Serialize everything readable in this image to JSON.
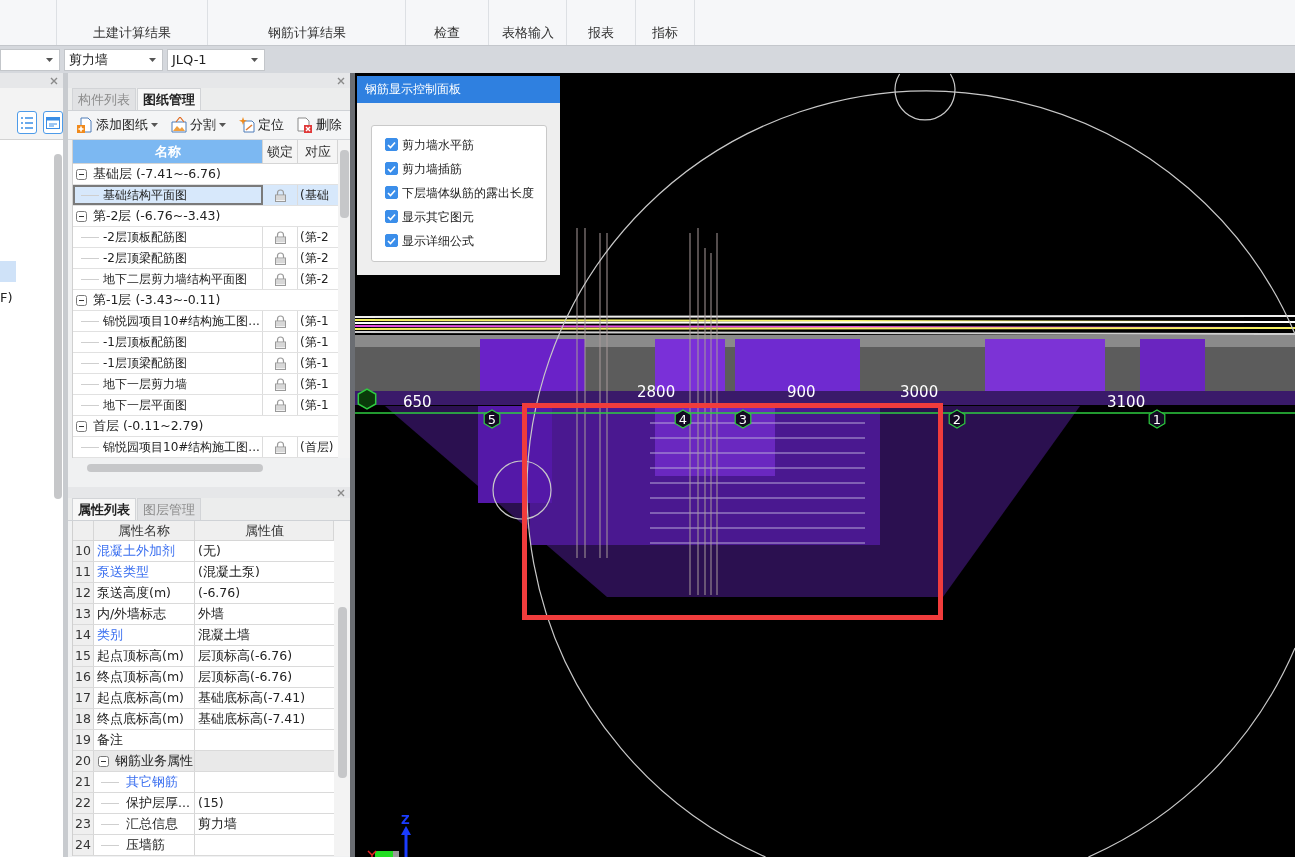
{
  "ribbon": {
    "groups": [
      {
        "label": "土建计算结果"
      },
      {
        "label": "钢筋计算结果"
      },
      {
        "label": "检查"
      },
      {
        "label": "表格输入"
      },
      {
        "label": "报表"
      },
      {
        "label": "指标"
      }
    ]
  },
  "selectors": [
    {
      "kind": "combo"
    },
    {
      "kind": "combo",
      "value": "剪力墙"
    },
    {
      "kind": "combo",
      "value": "JLQ-1"
    }
  ],
  "left_panel": {
    "items": [
      {
        "selected": true
      },
      {
        "label": "F)",
        "selected": false
      }
    ]
  },
  "drawing_panel": {
    "tabs": [
      {
        "label": "构件列表",
        "selected": false
      },
      {
        "label": "图纸管理",
        "selected": true
      }
    ],
    "toolbar": [
      {
        "kind": "add",
        "label": "添加图纸",
        "dropdown": true
      },
      {
        "kind": "split",
        "label": "分割",
        "dropdown": true
      },
      {
        "kind": "locate",
        "label": "定位",
        "dropdown": false
      },
      {
        "kind": "delete",
        "label": "删除",
        "dropdown": false
      }
    ],
    "columns": [
      {
        "label": "名称",
        "selected": true
      },
      {
        "label": "锁定",
        "selected": false
      },
      {
        "label": "对应",
        "selected": false
      }
    ],
    "groups": [
      {
        "label": "基础层 (-7.41~-6.76)",
        "expanded": true,
        "children": [
          {
            "name": "基础结构平面图",
            "locked": true,
            "floor": "(基础",
            "selected": true
          }
        ]
      },
      {
        "label": "第-2层 (-6.76~-3.43)",
        "expanded": true,
        "children": [
          {
            "name": "-2层顶板配筋图",
            "locked": true,
            "floor": "(第-2",
            "selected": false
          },
          {
            "name": "-2层顶梁配筋图",
            "locked": true,
            "floor": "(第-2",
            "selected": false
          },
          {
            "name": "地下二层剪力墙结构平面图",
            "locked": true,
            "floor": "(第-2",
            "selected": false
          }
        ]
      },
      {
        "label": "第-1层 (-3.43~-0.11)",
        "expanded": true,
        "children": [
          {
            "name": "锦悦园项目10#结构施工图...",
            "locked": true,
            "floor": "(第-1",
            "selected": false
          },
          {
            "name": "-1层顶板配筋图",
            "locked": true,
            "floor": "(第-1",
            "selected": false
          },
          {
            "name": "-1层顶梁配筋图",
            "locked": true,
            "floor": "(第-1",
            "selected": false
          },
          {
            "name": "地下一层剪力墙",
            "locked": true,
            "floor": "(第-1",
            "selected": false
          },
          {
            "name": "地下一层平面图",
            "locked": true,
            "floor": "(第-1",
            "selected": false
          }
        ]
      },
      {
        "label": "首层 (-0.11~2.79)",
        "expanded": true,
        "children": [
          {
            "name": "锦悦园项目10#结构施工图...",
            "locked": true,
            "floor": "(首层)",
            "selected": false
          }
        ]
      }
    ]
  },
  "property_panel": {
    "tabs": [
      {
        "label": "属性列表",
        "selected": true
      },
      {
        "label": "图层管理",
        "selected": false
      }
    ],
    "columns": [
      "属性名称",
      "属性值"
    ],
    "rows": [
      {
        "kind": "property",
        "index": "10",
        "name": "混凝土外加剂",
        "value": "(无)",
        "color": "#3a6ff0"
      },
      {
        "kind": "property",
        "index": "11",
        "name": "泵送类型",
        "value": "(混凝土泵)",
        "color": "#3a6ff0"
      },
      {
        "kind": "property",
        "index": "12",
        "name": "泵送高度(m)",
        "value": "(-6.76)"
      },
      {
        "kind": "property",
        "index": "13",
        "name": "内/外墙标志",
        "value": "外墙"
      },
      {
        "kind": "property",
        "index": "14",
        "name": "类别",
        "value": "混凝土墙",
        "color": "#3a6ff0"
      },
      {
        "kind": "property",
        "index": "15",
        "name": "起点顶标高(m)",
        "value": "层顶标高(-6.76)"
      },
      {
        "kind": "property",
        "index": "16",
        "name": "终点顶标高(m)",
        "value": "层顶标高(-6.76)"
      },
      {
        "kind": "property",
        "index": "17",
        "name": "起点底标高(m)",
        "value": "基础底标高(-7.41)"
      },
      {
        "kind": "property",
        "index": "18",
        "name": "终点底标高(m)",
        "value": "基础底标高(-7.41)"
      },
      {
        "kind": "property",
        "index": "19",
        "name": "备注"
      },
      {
        "kind": "group",
        "index": "20",
        "name": "钢筋业务属性",
        "expanded": true,
        "children": [
          {
            "kind": "property",
            "index": "21",
            "name": "其它钢筋",
            "color": "#3a6ff0"
          },
          {
            "kind": "property",
            "index": "22",
            "name": "保护层厚...",
            "value": "(15)"
          },
          {
            "kind": "property",
            "index": "23",
            "name": "汇总信息",
            "value": "剪力墙"
          },
          {
            "kind": "property",
            "index": "24",
            "name": "压墙筋"
          }
        ]
      }
    ]
  },
  "control_panel": {
    "title": "钢筋显示控制面板",
    "options": [
      {
        "label": "剪力墙水平筋",
        "checked": true
      },
      {
        "label": "剪力墙插筋",
        "checked": true
      },
      {
        "label": "下层墙体纵筋的露出长度",
        "checked": true
      },
      {
        "label": "显示其它图元",
        "checked": true
      },
      {
        "label": "显示详细公式",
        "checked": true
      }
    ]
  },
  "viewport": {
    "dimension_labels": [
      "650",
      "2800",
      "900",
      "3000",
      "3100"
    ],
    "axis_markers": [
      "5",
      "4",
      "3",
      "2",
      "1"
    ],
    "axis_label": "Z"
  }
}
